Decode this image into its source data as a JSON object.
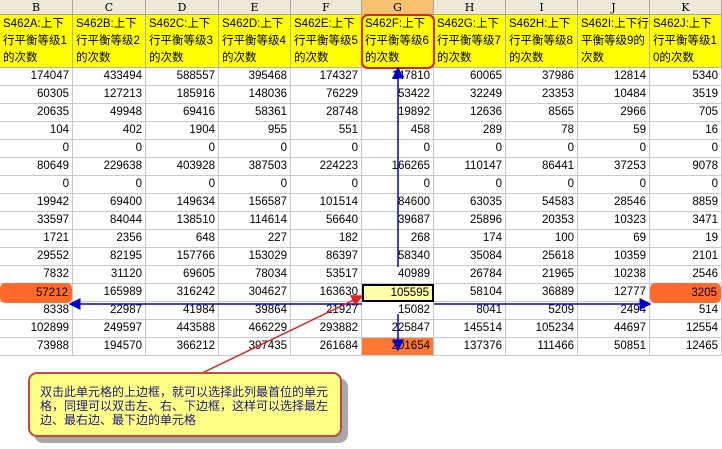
{
  "columns": [
    "B",
    "C",
    "D",
    "E",
    "F",
    "G",
    "H",
    "I",
    "J",
    "K"
  ],
  "selected_column": "G",
  "headers": [
    "S462A:上下行平衡等级1的次数",
    "S462B:上下行平衡等级2的次数",
    "S462C:上下行平衡等级3的次数",
    "S462D:上下行平衡等级4的次数",
    "S462E:上下行平衡等级5的次数",
    "S462F:上下行平衡等级6的次数",
    "S462G:上下行平衡等级7的次数",
    "S462H:上下行平衡等级8的次数",
    "S462I:上下行平衡等级9的次数",
    "S462J:上下行平衡等级10的次数"
  ],
  "rows": [
    [
      "174047",
      "433494",
      "588557",
      "395468",
      "174327",
      "147810",
      "60065",
      "37986",
      "12814",
      "5340"
    ],
    [
      "60305",
      "127213",
      "185916",
      "148036",
      "76229",
      "53422",
      "32249",
      "23353",
      "10484",
      "3519"
    ],
    [
      "20635",
      "49948",
      "69416",
      "58361",
      "28748",
      "19892",
      "12636",
      "8565",
      "2966",
      "705"
    ],
    [
      "104",
      "402",
      "1904",
      "955",
      "551",
      "458",
      "289",
      "78",
      "59",
      "16"
    ],
    [
      "0",
      "0",
      "0",
      "0",
      "0",
      "0",
      "0",
      "0",
      "0",
      "0"
    ],
    [
      "80649",
      "229638",
      "403928",
      "387503",
      "224223",
      "166265",
      "110147",
      "86441",
      "37253",
      "9078"
    ],
    [
      "0",
      "0",
      "0",
      "0",
      "0",
      "0",
      "0",
      "0",
      "0",
      "0"
    ],
    [
      "19942",
      "69400",
      "149634",
      "156587",
      "101514",
      "84600",
      "63035",
      "54583",
      "28546",
      "8859"
    ],
    [
      "33597",
      "84044",
      "138510",
      "114614",
      "56640",
      "39687",
      "25896",
      "20353",
      "10323",
      "3471"
    ],
    [
      "1721",
      "2356",
      "648",
      "227",
      "182",
      "268",
      "174",
      "100",
      "69",
      "19"
    ],
    [
      "29552",
      "82195",
      "157766",
      "153029",
      "86397",
      "58340",
      "35084",
      "25618",
      "10359",
      "2101"
    ],
    [
      "7832",
      "31120",
      "69605",
      "78034",
      "53517",
      "40989",
      "26784",
      "21965",
      "10238",
      "2546"
    ],
    [
      "57212",
      "165989",
      "316242",
      "304627",
      "163630",
      "105595",
      "58104",
      "36889",
      "12777",
      "3205"
    ],
    [
      "8338",
      "22987",
      "41984",
      "39864",
      "21927",
      "15082",
      "8041",
      "5209",
      "2494",
      "514"
    ],
    [
      "102899",
      "249597",
      "443588",
      "466229",
      "293882",
      "225847",
      "145514",
      "105234",
      "44697",
      "12554"
    ],
    [
      "73988",
      "194570",
      "366212",
      "397435",
      "261684",
      "201654",
      "137376",
      "111466",
      "50851",
      "12465"
    ]
  ],
  "active_cell": {
    "row": 12,
    "col": 5
  },
  "highlights": {
    "left": {
      "row": 12,
      "col": 0,
      "value": "57212"
    },
    "right": {
      "row": 12,
      "col": 9,
      "value": "3205"
    },
    "bottom": {
      "row": 15,
      "col": 5,
      "value": "201654"
    }
  },
  "callout_text": "双击此单元格的上边框，就可以选择此列最首位的单元格，同理可以双击左、右、下边框，这样可以选择最左边、最右边、最下边的单元格",
  "colors": {
    "header_bg": "#ffff00",
    "highlight": "#ff6a2a",
    "arrow_blue": "#0000cc",
    "arrow_red": "#e02020",
    "callout_bg": "#ffff86"
  }
}
